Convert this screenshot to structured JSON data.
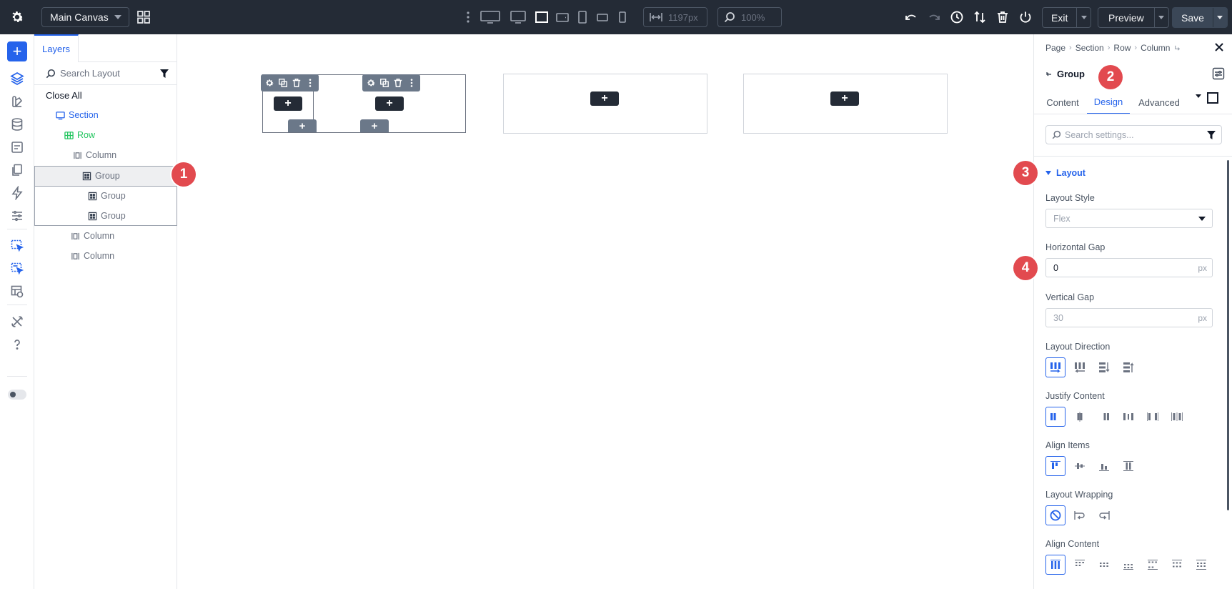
{
  "topbar": {
    "canvas_select": "Main Canvas",
    "width_readout": "1197px",
    "zoom_readout": "100%",
    "exit_label": "Exit",
    "preview_label": "Preview",
    "save_label": "Save"
  },
  "layers": {
    "tab_label": "Layers",
    "search_placeholder": "Search Layout",
    "close_all": "Close All",
    "items": [
      {
        "label": "Section",
        "kind": "section"
      },
      {
        "label": "Row",
        "kind": "row"
      },
      {
        "label": "Column",
        "kind": "column"
      },
      {
        "label": "Group",
        "kind": "group"
      },
      {
        "label": "Group",
        "kind": "group"
      },
      {
        "label": "Group",
        "kind": "group"
      },
      {
        "label": "Column",
        "kind": "column"
      },
      {
        "label": "Column",
        "kind": "column"
      }
    ]
  },
  "settings": {
    "breadcrumbs": [
      "Page",
      "Section",
      "Row",
      "Column"
    ],
    "module_title": "Group",
    "tabs": [
      "Content",
      "Design",
      "Advanced"
    ],
    "active_tab": "Design",
    "search_placeholder": "Search settings...",
    "section_title": "Layout",
    "layout_style_label": "Layout Style",
    "layout_style_value": "Flex",
    "hgap_label": "Horizontal Gap",
    "hgap_value": "0",
    "hgap_unit": "px",
    "vgap_label": "Vertical Gap",
    "vgap_placeholder": "30",
    "vgap_unit": "px",
    "direction_label": "Layout Direction",
    "justify_label": "Justify Content",
    "align_items_label": "Align Items",
    "wrapping_label": "Layout Wrapping",
    "align_content_label": "Align Content"
  },
  "markers": [
    "1",
    "2",
    "3",
    "4"
  ],
  "colors": {
    "accent": "#2563eb",
    "topbar": "#242b36",
    "marker": "#e24a4f",
    "row_green": "#22c55e"
  }
}
